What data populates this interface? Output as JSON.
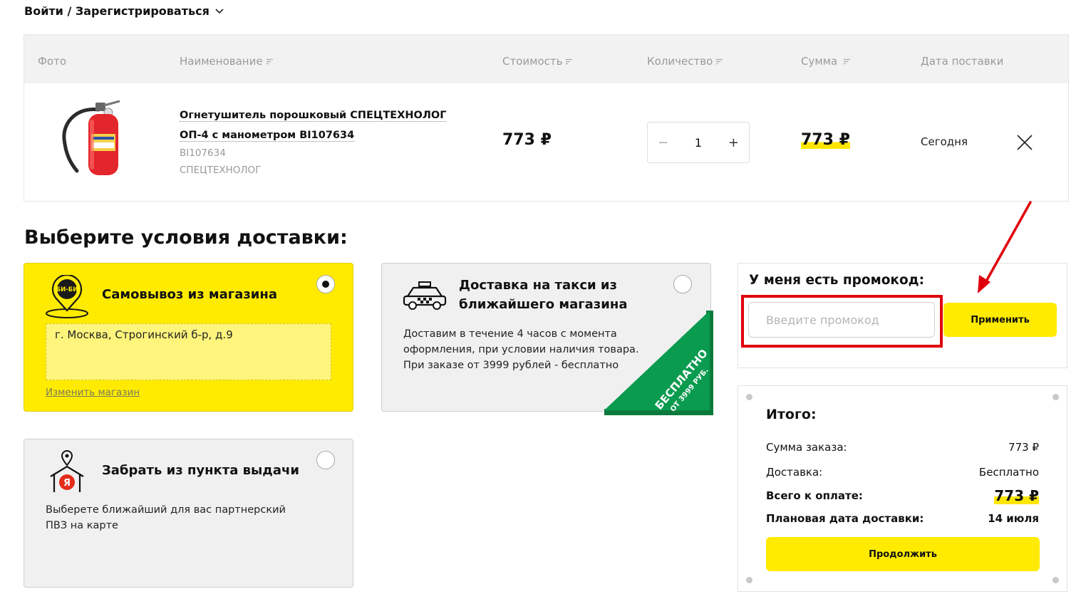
{
  "header": {
    "login_label": "Войти / Зарегистрироваться"
  },
  "cart": {
    "columns": {
      "photo": "Фото",
      "name": "Наименование",
      "price": "Стоимость",
      "quantity": "Количество",
      "sum": "Сумма",
      "delivery_date": "Дата поставки"
    },
    "item": {
      "name_line1": "Огнетушитель порошковый СПЕЦТЕХНОЛОГ",
      "name_line2": "ОП-4 с манометром BI107634",
      "code": "BI107634",
      "brand": "СПЕЦТЕХНОЛОГ",
      "price": "773 ₽",
      "quantity": "1",
      "sum": "773 ₽",
      "delivery_date": "Сегодня"
    }
  },
  "delivery": {
    "title": "Выберите условия доставки:",
    "options": [
      {
        "title": "Самовывоз из магазина",
        "logo_text": "БИ-БИ",
        "address": "г. Москва, Строгинский б-р, д.9",
        "change_link": "Изменить магазин",
        "selected": true
      },
      {
        "title_line1": "Доставка на такси из",
        "title_line2": "ближайшего магазина",
        "text_line1": "Доставим в течение 4 часов с момента",
        "text_line2": "оформления, при условии наличия товара.",
        "text_line3": "При заказе от 3999 рублей - бесплатно",
        "ribbon_line1": "БЕСПЛАТНО",
        "ribbon_line2": "ОТ 3999 РУБ.",
        "selected": false
      },
      {
        "title": "Забрать из пункта выдачи",
        "text_line1": "Выберете ближайший для вас партнерский",
        "text_line2": "ПВЗ на карте",
        "selected": false
      }
    ]
  },
  "promo": {
    "title": "У меня есть промокод:",
    "placeholder": "Введите промокод",
    "apply_label": "Применить"
  },
  "summary": {
    "title": "Итого:",
    "order_sum_label": "Сумма заказа:",
    "order_sum_value": "773 ₽",
    "delivery_label": "Доставка:",
    "delivery_value": "Бесплатно",
    "total_label": "Всего к оплате:",
    "total_value": "773 ₽",
    "planned_date_label": "Плановая дата доставки:",
    "planned_date_value": "14 июля",
    "continue_label": "Продолжить"
  },
  "colors": {
    "accent_yellow": "#ffeb00",
    "highlight_red": "#e0000c",
    "ribbon_green": "#0a9b4f"
  }
}
